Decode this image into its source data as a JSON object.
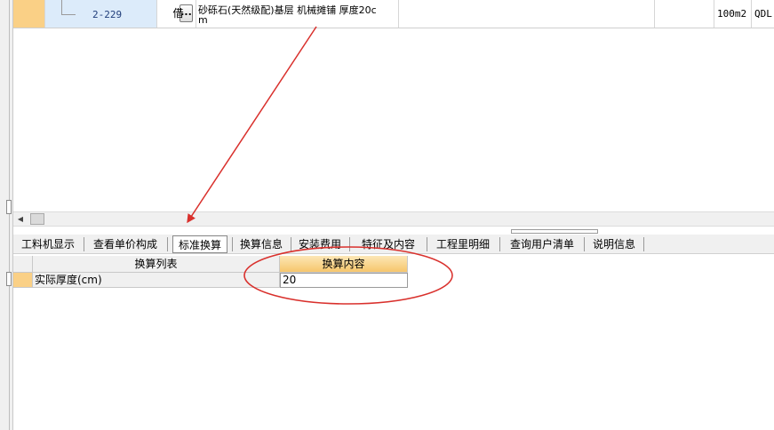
{
  "top_row": {
    "code": "2-229",
    "ellipsis_label": "...",
    "type": "借",
    "name_line1": "砂砾石(天然级配)基层 机械摊铺 厚度20c",
    "name_line2": "m",
    "unit": "100m2",
    "source": "QDL"
  },
  "tabs": [
    {
      "label": "工料机显示"
    },
    {
      "label": "查看单价构成"
    },
    {
      "label": "标准换算"
    },
    {
      "label": "换算信息"
    },
    {
      "label": "安装费用"
    },
    {
      "label": "特征及内容"
    },
    {
      "label": "工程里明细"
    },
    {
      "label": "查询用户清单"
    },
    {
      "label": "说明信息"
    }
  ],
  "conversion_table": {
    "headers": [
      "换算列表",
      "换算内容"
    ],
    "rows": [
      {
        "name": "实际厚度(cm)",
        "value": "20"
      }
    ]
  },
  "annotation_color": "#d9302c",
  "accent_color": "#fad086"
}
